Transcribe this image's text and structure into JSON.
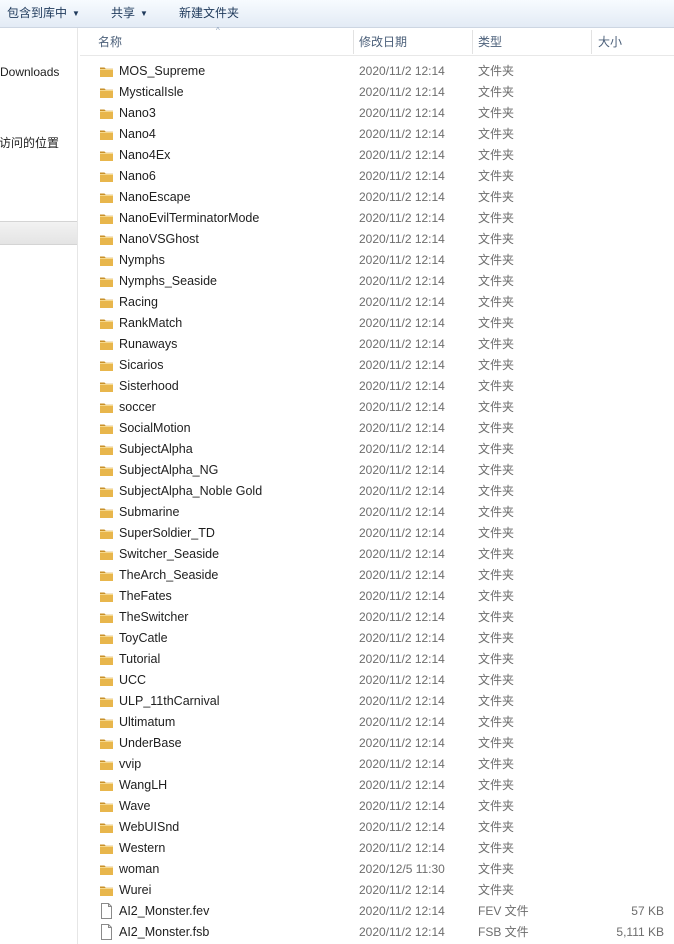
{
  "toolbar": {
    "include_library_label": "包含到库中",
    "share_label": "共享",
    "new_folder_label": "新建文件夹",
    "dropdown_glyph": "▼"
  },
  "nav": {
    "downloads_label": "Downloads",
    "recent_places_label": "访问的位置"
  },
  "columns": {
    "name": "名称",
    "date_modified": "修改日期",
    "type": "类型",
    "size": "大小",
    "sort_glyph": "^"
  },
  "files": [
    {
      "name": "MOS_Supreme",
      "date": "2020/11/2 12:14",
      "type": "文件夹",
      "size": "",
      "kind": "folder"
    },
    {
      "name": "MysticalIsle",
      "date": "2020/11/2 12:14",
      "type": "文件夹",
      "size": "",
      "kind": "folder"
    },
    {
      "name": "Nano3",
      "date": "2020/11/2 12:14",
      "type": "文件夹",
      "size": "",
      "kind": "folder"
    },
    {
      "name": "Nano4",
      "date": "2020/11/2 12:14",
      "type": "文件夹",
      "size": "",
      "kind": "folder"
    },
    {
      "name": "Nano4Ex",
      "date": "2020/11/2 12:14",
      "type": "文件夹",
      "size": "",
      "kind": "folder"
    },
    {
      "name": "Nano6",
      "date": "2020/11/2 12:14",
      "type": "文件夹",
      "size": "",
      "kind": "folder"
    },
    {
      "name": "NanoEscape",
      "date": "2020/11/2 12:14",
      "type": "文件夹",
      "size": "",
      "kind": "folder"
    },
    {
      "name": "NanoEvilTerminatorMode",
      "date": "2020/11/2 12:14",
      "type": "文件夹",
      "size": "",
      "kind": "folder"
    },
    {
      "name": "NanoVSGhost",
      "date": "2020/11/2 12:14",
      "type": "文件夹",
      "size": "",
      "kind": "folder"
    },
    {
      "name": "Nymphs",
      "date": "2020/11/2 12:14",
      "type": "文件夹",
      "size": "",
      "kind": "folder"
    },
    {
      "name": "Nymphs_Seaside",
      "date": "2020/11/2 12:14",
      "type": "文件夹",
      "size": "",
      "kind": "folder"
    },
    {
      "name": "Racing",
      "date": "2020/11/2 12:14",
      "type": "文件夹",
      "size": "",
      "kind": "folder"
    },
    {
      "name": "RankMatch",
      "date": "2020/11/2 12:14",
      "type": "文件夹",
      "size": "",
      "kind": "folder"
    },
    {
      "name": "Runaways",
      "date": "2020/11/2 12:14",
      "type": "文件夹",
      "size": "",
      "kind": "folder"
    },
    {
      "name": "Sicarios",
      "date": "2020/11/2 12:14",
      "type": "文件夹",
      "size": "",
      "kind": "folder"
    },
    {
      "name": "Sisterhood",
      "date": "2020/11/2 12:14",
      "type": "文件夹",
      "size": "",
      "kind": "folder"
    },
    {
      "name": "soccer",
      "date": "2020/11/2 12:14",
      "type": "文件夹",
      "size": "",
      "kind": "folder"
    },
    {
      "name": "SocialMotion",
      "date": "2020/11/2 12:14",
      "type": "文件夹",
      "size": "",
      "kind": "folder"
    },
    {
      "name": "SubjectAlpha",
      "date": "2020/11/2 12:14",
      "type": "文件夹",
      "size": "",
      "kind": "folder"
    },
    {
      "name": "SubjectAlpha_NG",
      "date": "2020/11/2 12:14",
      "type": "文件夹",
      "size": "",
      "kind": "folder"
    },
    {
      "name": "SubjectAlpha_Noble Gold",
      "date": "2020/11/2 12:14",
      "type": "文件夹",
      "size": "",
      "kind": "folder"
    },
    {
      "name": "Submarine",
      "date": "2020/11/2 12:14",
      "type": "文件夹",
      "size": "",
      "kind": "folder"
    },
    {
      "name": "SuperSoldier_TD",
      "date": "2020/11/2 12:14",
      "type": "文件夹",
      "size": "",
      "kind": "folder"
    },
    {
      "name": "Switcher_Seaside",
      "date": "2020/11/2 12:14",
      "type": "文件夹",
      "size": "",
      "kind": "folder"
    },
    {
      "name": "TheArch_Seaside",
      "date": "2020/11/2 12:14",
      "type": "文件夹",
      "size": "",
      "kind": "folder"
    },
    {
      "name": "TheFates",
      "date": "2020/11/2 12:14",
      "type": "文件夹",
      "size": "",
      "kind": "folder"
    },
    {
      "name": "TheSwitcher",
      "date": "2020/11/2 12:14",
      "type": "文件夹",
      "size": "",
      "kind": "folder"
    },
    {
      "name": "ToyCatle",
      "date": "2020/11/2 12:14",
      "type": "文件夹",
      "size": "",
      "kind": "folder"
    },
    {
      "name": "Tutorial",
      "date": "2020/11/2 12:14",
      "type": "文件夹",
      "size": "",
      "kind": "folder"
    },
    {
      "name": "UCC",
      "date": "2020/11/2 12:14",
      "type": "文件夹",
      "size": "",
      "kind": "folder"
    },
    {
      "name": "ULP_11thCarnival",
      "date": "2020/11/2 12:14",
      "type": "文件夹",
      "size": "",
      "kind": "folder"
    },
    {
      "name": "Ultimatum",
      "date": "2020/11/2 12:14",
      "type": "文件夹",
      "size": "",
      "kind": "folder"
    },
    {
      "name": "UnderBase",
      "date": "2020/11/2 12:14",
      "type": "文件夹",
      "size": "",
      "kind": "folder"
    },
    {
      "name": "vvip",
      "date": "2020/11/2 12:14",
      "type": "文件夹",
      "size": "",
      "kind": "folder"
    },
    {
      "name": "WangLH",
      "date": "2020/11/2 12:14",
      "type": "文件夹",
      "size": "",
      "kind": "folder"
    },
    {
      "name": "Wave",
      "date": "2020/11/2 12:14",
      "type": "文件夹",
      "size": "",
      "kind": "folder"
    },
    {
      "name": "WebUISnd",
      "date": "2020/11/2 12:14",
      "type": "文件夹",
      "size": "",
      "kind": "folder"
    },
    {
      "name": "Western",
      "date": "2020/11/2 12:14",
      "type": "文件夹",
      "size": "",
      "kind": "folder"
    },
    {
      "name": "woman",
      "date": "2020/12/5 11:30",
      "type": "文件夹",
      "size": "",
      "kind": "folder"
    },
    {
      "name": "Wurei",
      "date": "2020/11/2 12:14",
      "type": "文件夹",
      "size": "",
      "kind": "folder"
    },
    {
      "name": "AI2_Monster.fev",
      "date": "2020/11/2 12:14",
      "type": "FEV 文件",
      "size": "57 KB",
      "kind": "file"
    },
    {
      "name": "AI2_Monster.fsb",
      "date": "2020/11/2 12:14",
      "type": "FSB 文件",
      "size": "5,111 KB",
      "kind": "file"
    }
  ],
  "colors": {
    "folder": "#e8b64c",
    "folder_dark": "#c9912a",
    "toolbar_text": "#1e395b"
  }
}
